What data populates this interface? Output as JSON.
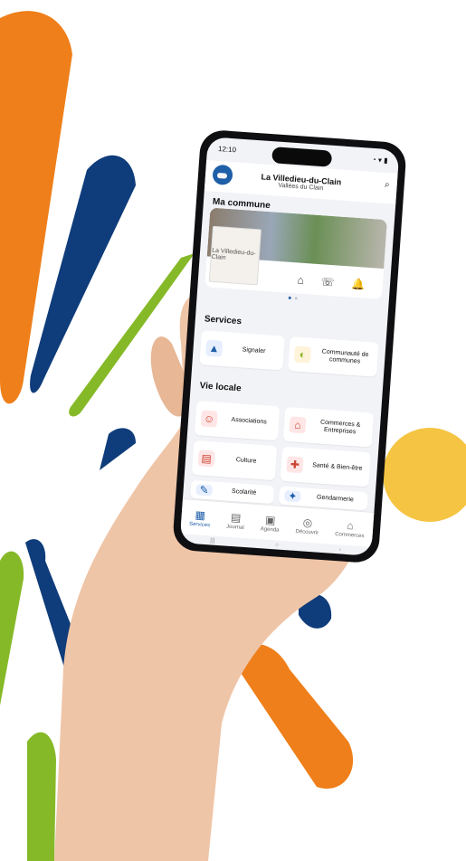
{
  "colors": {
    "accent": "#1f5fa8",
    "orange": "#ef7f1a",
    "navy": "#0f3c7a",
    "green": "#86b928",
    "yellow": "#f5c443"
  },
  "status_time": "12:10",
  "header": {
    "title": "La Villedieu-du-Clain",
    "subtitle": "Vallées du Clain",
    "search_icon": "search-icon"
  },
  "commune": {
    "title": "Ma commune",
    "badge_text": "La Villedieu-du-Clain"
  },
  "services": {
    "title": "Services",
    "signaler": "Signaler",
    "communaute": "Communauté de communes"
  },
  "vie": {
    "title": "Vie locale",
    "associations": "Associations",
    "commerces": "Commerces & Entreprises",
    "culture": "Culture",
    "sante": "Santé & Bien-être",
    "scolarite": "Scolarité",
    "gendarmerie": "Gendarmerie"
  },
  "nav": {
    "services": "Services",
    "journal": "Journal",
    "agenda": "Agenda",
    "decouvrir": "Découvrir",
    "commerces": "Commerces"
  }
}
